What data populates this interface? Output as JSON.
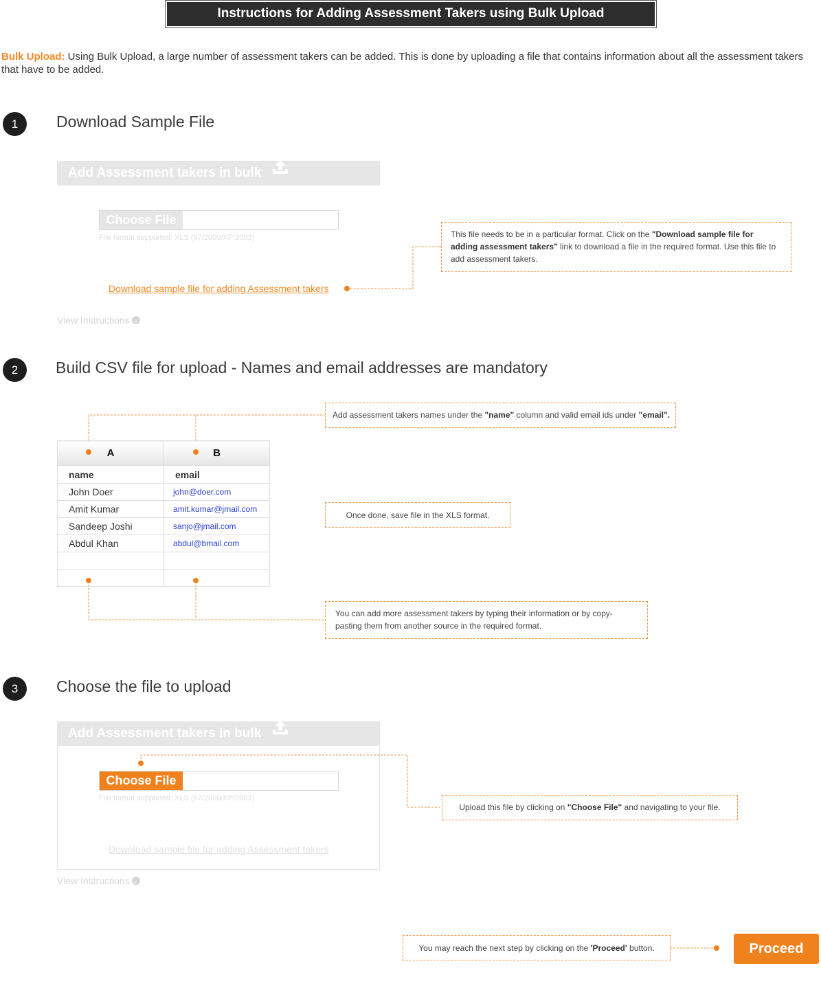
{
  "header": {
    "title": "Instructions for Adding Assessment Takers using Bulk Upload"
  },
  "intro": {
    "lead": "Bulk Upload:",
    "text": "Using Bulk Upload, a large number of assessment takers can be added. This is done by uploading a file that contains information about all the assessment takers that have to be added."
  },
  "steps": [
    {
      "number": "1",
      "title": "Download Sample File"
    },
    {
      "number": "2",
      "title": "Build CSV file for upload - Names and email addresses are mandatory"
    },
    {
      "number": "3",
      "title": "Choose the file to upload"
    }
  ],
  "upload_panel": {
    "title": "Add Assessment takers in bulk",
    "choose_file": "Choose File",
    "file_format": "File format supported: XLS (97/2000/XP/2003)",
    "download_link": "Download sample file for adding Assessment takers",
    "view_instructions": "View Instructions"
  },
  "callouts": {
    "download": {
      "pre": "This file needs to be in a particular format. Click on the ",
      "bold": "\"Download sample file for adding assessment takers\"",
      "post": " link to download a file in the required format. Use this file to add assessment takers."
    },
    "columns": {
      "pre": "Add assessment takers names under the ",
      "bold1": "\"name\"",
      "mid": " column and valid email ids under ",
      "bold2": "\"email\"."
    },
    "save": {
      "text": "Once done, save file in the XLS format."
    },
    "more": {
      "text": "You can add more assessment takers by typing their information or by copy-pasting them from another source in the required format."
    },
    "choose": {
      "pre": "Upload this file by clicking on ",
      "bold": "\"Choose File\"",
      "post": " and navigating to your file."
    },
    "proceed": {
      "pre": "You may reach the next step by clicking on the ",
      "bold": "'Proceed'",
      "post": " button."
    }
  },
  "spreadsheet": {
    "column_letters": [
      "A",
      "B"
    ],
    "headers": [
      "name",
      "email"
    ],
    "rows": [
      {
        "name": "John Doer",
        "email": "john@doer.com"
      },
      {
        "name": "Amit Kumar",
        "email": "amit.kumar@jmail.com"
      },
      {
        "name": "Sandeep Joshi",
        "email": "sanjo@jmail.com"
      },
      {
        "name": "Abdul Khan",
        "email": "abdul@bmail.com"
      }
    ]
  },
  "proceed_button": {
    "label": "Proceed"
  },
  "colors": {
    "accent": "#f0821e",
    "title_bar": "#2d2d2d",
    "panel_faded": "#e6e6e6",
    "email_link": "#2a3fd6"
  },
  "icons": {
    "upload": "upload-icon",
    "chevron": "chevron-down-icon"
  }
}
